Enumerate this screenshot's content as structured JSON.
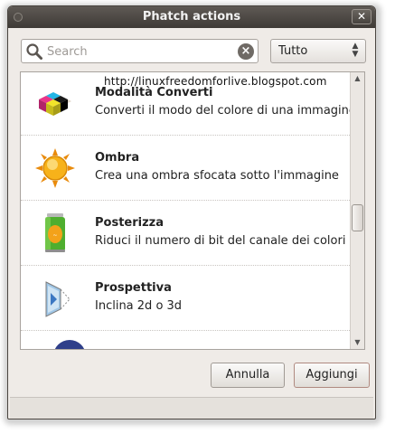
{
  "window": {
    "title": "Phatch actions",
    "close_glyph": "✕"
  },
  "search": {
    "placeholder": "Search",
    "value": "",
    "clear_glyph": "×"
  },
  "filter": {
    "selected": "Tutto",
    "arrows": "▲▼"
  },
  "watermark": "http://linuxfreedomforlive.blogspot.com",
  "actions": [
    {
      "title": "Modalità Converti",
      "description": "Converti il modo del colore di una immagine",
      "icon": "color-mode-cubes-icon"
    },
    {
      "title": "Ombra",
      "description": "Crea una ombra sfocata sotto l'immagine",
      "icon": "sun-shadow-icon"
    },
    {
      "title": "Posterizza",
      "description": "Riduci il numero di bit del canale dei colori",
      "icon": "soda-can-icon"
    },
    {
      "title": "Prospettiva",
      "description": "Inclina 2d o 3d",
      "icon": "perspective-icon"
    }
  ],
  "buttons": {
    "cancel_label": "Annulla",
    "add_label": "Aggiungi"
  },
  "scroll": {
    "up_glyph": "▲",
    "down_glyph": "▼"
  }
}
